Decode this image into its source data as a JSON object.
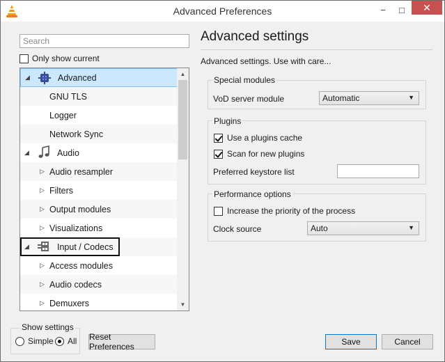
{
  "window": {
    "title": "Advanced Preferences",
    "close_glyph": "✕",
    "minimize_glyph": "−",
    "maximize_glyph": "□"
  },
  "search": {
    "placeholder": "Search",
    "value": ""
  },
  "only_show_current": {
    "label": "Only show current",
    "checked": false
  },
  "tree": {
    "items": [
      {
        "label": "Advanced",
        "expanded": true,
        "level": 0,
        "icon": "advanced-gear-icon",
        "selected": true
      },
      {
        "label": "GNU TLS",
        "level": 1
      },
      {
        "label": "Logger",
        "level": 1
      },
      {
        "label": "Network Sync",
        "level": 1
      },
      {
        "label": "Audio",
        "expanded": true,
        "level": 0,
        "icon": "audio-note-icon"
      },
      {
        "label": "Audio resampler",
        "level": 1,
        "collapsed": true
      },
      {
        "label": "Filters",
        "level": 1,
        "collapsed": true
      },
      {
        "label": "Output modules",
        "level": 1,
        "collapsed": true
      },
      {
        "label": "Visualizations",
        "level": 1,
        "collapsed": true
      },
      {
        "label": "Input / Codecs",
        "expanded": true,
        "level": 0,
        "icon": "input-codecs-icon",
        "focused": true
      },
      {
        "label": "Access modules",
        "level": 1,
        "collapsed": true
      },
      {
        "label": "Audio codecs",
        "level": 1,
        "collapsed": true
      },
      {
        "label": "Demuxers",
        "level": 1,
        "collapsed": true
      }
    ]
  },
  "panel": {
    "heading": "Advanced settings",
    "subtitle": "Advanced settings. Use with care...",
    "special_modules": {
      "title": "Special modules",
      "vod_label": "VoD server module",
      "vod_value": "Automatic"
    },
    "plugins": {
      "title": "Plugins",
      "use_cache_label": "Use a plugins cache",
      "use_cache_checked": true,
      "scan_label": "Scan for new plugins",
      "scan_checked": true,
      "keystore_label": "Preferred keystore list",
      "keystore_value": ""
    },
    "performance": {
      "title": "Performance options",
      "priority_label": "Increase the priority of the process",
      "priority_checked": false,
      "clock_label": "Clock source",
      "clock_value": "Auto"
    }
  },
  "show_settings": {
    "title": "Show settings",
    "simple_label": "Simple",
    "all_label": "All",
    "selected": "All"
  },
  "buttons": {
    "reset": "Reset Preferences",
    "save": "Save",
    "cancel": "Cancel"
  },
  "colors": {
    "selection_bg": "#cce8ff",
    "selection_border": "#7cc3f3",
    "close_red": "#c75050",
    "accent_blue": "#0078d7"
  }
}
